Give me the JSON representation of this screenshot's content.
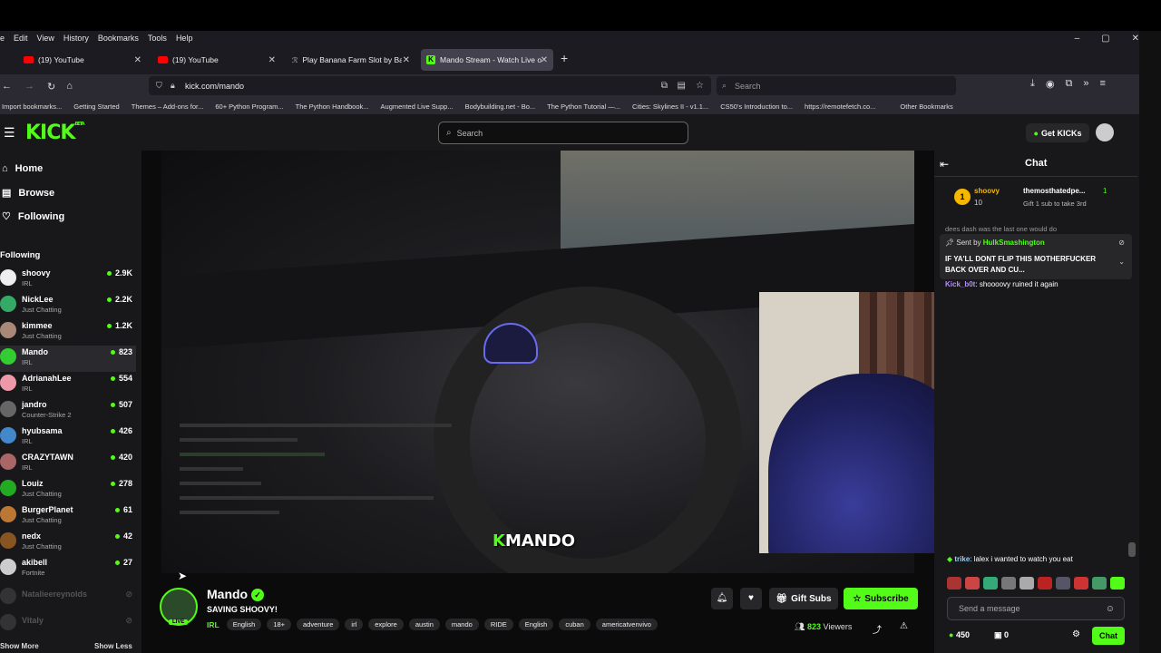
{
  "browser": {
    "menu": [
      "e",
      "Edit",
      "View",
      "History",
      "Bookmarks",
      "Tools",
      "Help"
    ],
    "window_controls": [
      "–",
      "▢",
      "✕"
    ],
    "tabs": [
      {
        "label": "(19) YouTube",
        "icon": "youtube-icon"
      },
      {
        "label": "(19) YouTube",
        "icon": "youtube-icon"
      },
      {
        "label": "Play Banana Farm Slot by Backs",
        "icon": "slot-icon"
      },
      {
        "label": "Mando Stream - Watch Live on",
        "icon": "kick-icon"
      }
    ],
    "url": "kick.com/mando",
    "search_placeholder": "Search",
    "bookmarks": [
      "Import bookmarks...",
      "Getting Started",
      "Themes – Add-ons for...",
      "60+ Python Program...",
      "The Python Handbook...",
      "Augmented Live Supp...",
      "Bodybuilding.net - Bo...",
      "The Python Tutorial —...",
      "Cities: Skylines II - v1.1...",
      "CS50's Introduction to...",
      "https://remotefetch.co...",
      "Other Bookmarks"
    ]
  },
  "kick": {
    "logo": "KICK",
    "logo_sup": "BETA",
    "search_placeholder": "Search",
    "get_kicks": "Get KICKs",
    "nav": [
      {
        "label": "Home",
        "icon": "home-icon"
      },
      {
        "label": "Browse",
        "icon": "browse-icon"
      },
      {
        "label": "Following",
        "icon": "heart-icon"
      }
    ],
    "following_header": "Following",
    "following": [
      {
        "name": "shoovy",
        "category": "IRL",
        "viewers": "2.9K"
      },
      {
        "name": "NickLee",
        "category": "Just Chatting",
        "viewers": "2.2K"
      },
      {
        "name": "kimmee",
        "category": "Just Chatting",
        "viewers": "1.2K"
      },
      {
        "name": "Mando",
        "category": "IRL",
        "viewers": "823"
      },
      {
        "name": "AdrianahLee",
        "category": "IRL",
        "viewers": "554"
      },
      {
        "name": "jandro",
        "category": "Counter-Strike 2",
        "viewers": "507"
      },
      {
        "name": "hyubsama",
        "category": "IRL",
        "viewers": "426"
      },
      {
        "name": "CRAZYTAWN",
        "category": "IRL",
        "viewers": "420"
      },
      {
        "name": "Louiz",
        "category": "Just Chatting",
        "viewers": "278"
      },
      {
        "name": "BurgerPlanet",
        "category": "Just Chatting",
        "viewers": "61"
      },
      {
        "name": "nedx",
        "category": "Just Chatting",
        "viewers": "42"
      },
      {
        "name": "akibell",
        "category": "Fortnite",
        "viewers": "27"
      }
    ],
    "offline": [
      "Natalieereynolds",
      "Vitaly"
    ],
    "show_more": "Show More",
    "show_less": "Show Less",
    "stream": {
      "streamer": "Mando",
      "live_badge": "LIVE",
      "title": "SAVING SHOOVY!",
      "category": "IRL",
      "tags": [
        "English",
        "18+",
        "adventure",
        "irl",
        "explore",
        "austin",
        "mando",
        "RIDE",
        "English",
        "cuban",
        "americatvenvivo"
      ],
      "gift_subs": "Gift Subs",
      "subscribe": "Subscribe",
      "viewers_count": "823",
      "viewers_label": "Viewers",
      "overlay_logo_k": "K",
      "overlay_logo_name": "MANDO"
    },
    "chat": {
      "title": "Chat",
      "pinned": {
        "rank": "1",
        "user": "shoovy",
        "amount": "10",
        "gifter": "themosthatedpe...",
        "gifter_count": "1",
        "sub_text": "Gift 1 sub to take 3rd"
      },
      "banner": {
        "sent_by_label": "Sent by",
        "sent_by_user": "HulkSmashington",
        "message": "IF YA'LL DONT FLIP THIS MOTHERFUCKER BACK OVER AND CU..."
      },
      "partial_line": "dees dash was the last one would do",
      "messages": [
        {
          "user": "Kick_b0t",
          "text": "shoooovy ruined it again"
        },
        {
          "user": "trike",
          "text": "lalex i wanted to watch you eat"
        }
      ],
      "input_placeholder": "Send a message",
      "kicks_balance": "450",
      "gift_count": "0",
      "send_label": "Chat"
    }
  }
}
